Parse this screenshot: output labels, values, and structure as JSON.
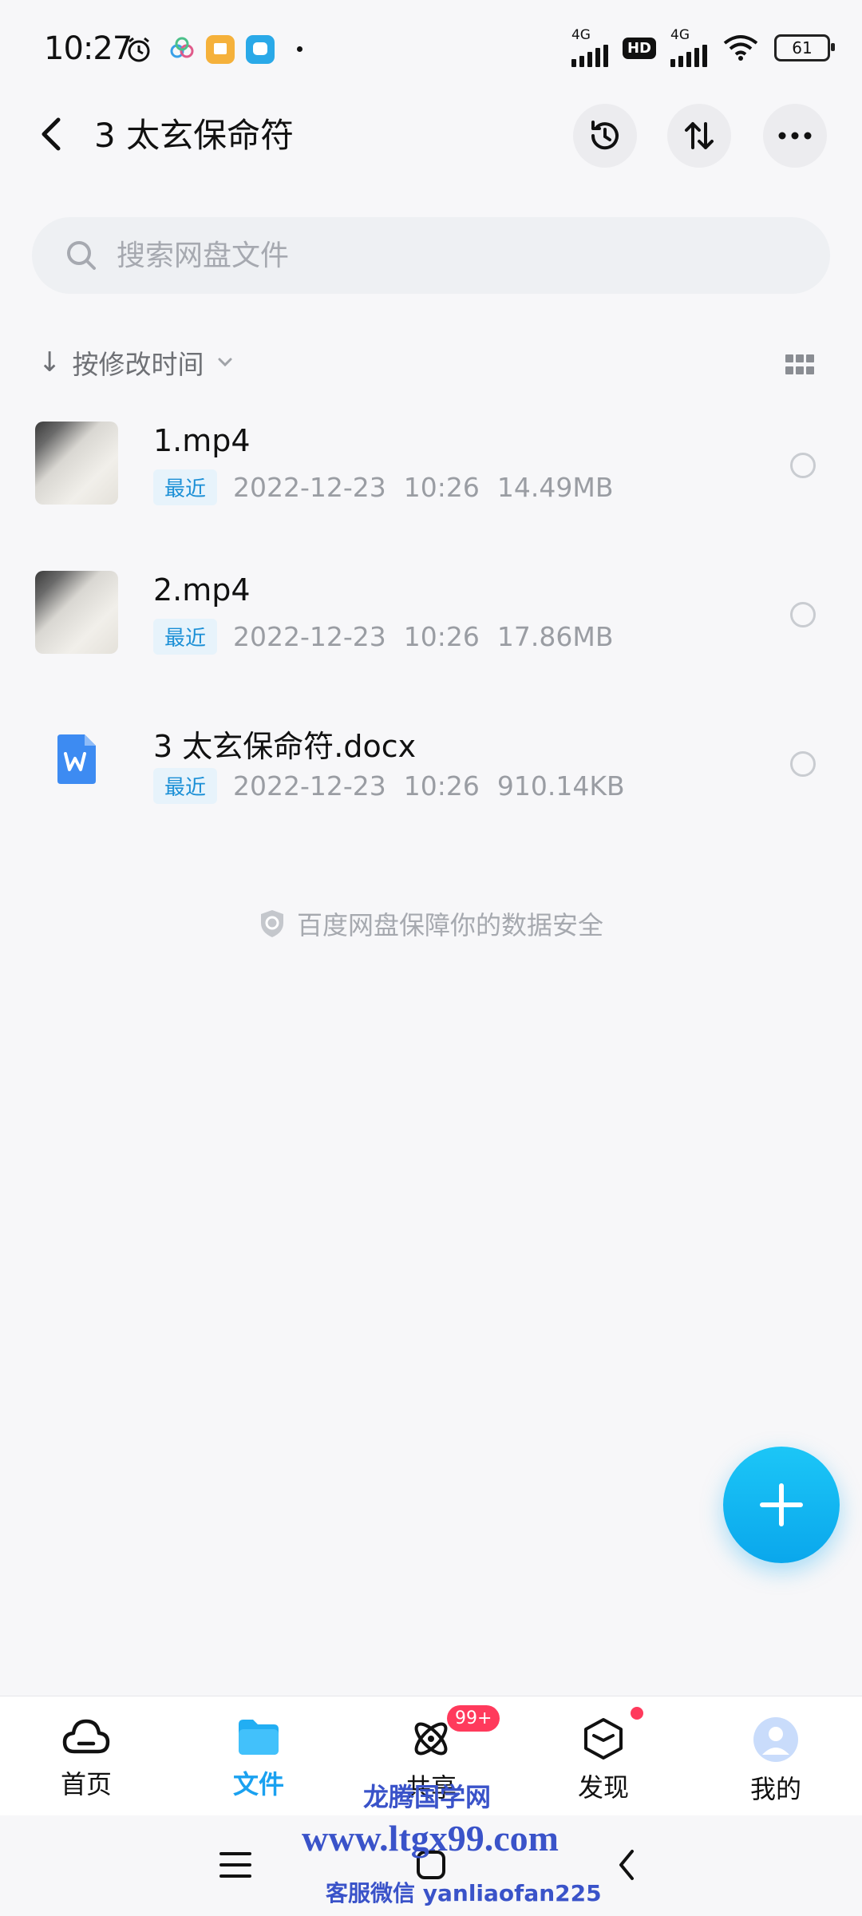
{
  "status_bar": {
    "time": "10:27",
    "network_1": "4G",
    "hd": "HD",
    "network_2": "4G",
    "battery": "61"
  },
  "header": {
    "title": "3 太玄保命符"
  },
  "search": {
    "placeholder": "搜索网盘文件"
  },
  "sort": {
    "label": "按修改时间"
  },
  "files": [
    {
      "name": "1.mp4",
      "tag": "最近",
      "date": "2022-12-23",
      "time": "10:26",
      "size": "14.49MB",
      "type": "video"
    },
    {
      "name": "2.mp4",
      "tag": "最近",
      "date": "2022-12-23",
      "time": "10:26",
      "size": "17.86MB",
      "type": "video"
    },
    {
      "name": "3 太玄保命符.docx",
      "tag": "最近",
      "date": "2022-12-23",
      "time": "10:26",
      "size": "910.14KB",
      "type": "docx"
    }
  ],
  "footer_note": "百度网盘保障你的数据安全",
  "tabs": [
    {
      "label": "首页",
      "icon": "cloud-icon"
    },
    {
      "label": "文件",
      "icon": "folder-icon"
    },
    {
      "label": "共享",
      "icon": "atom-icon",
      "badge": "99+"
    },
    {
      "label": "发现",
      "icon": "cube-icon"
    },
    {
      "label": "我的",
      "icon": "avatar-icon"
    }
  ],
  "watermark": {
    "line1": "龙腾国学网",
    "line2": "www.ltgx99.com",
    "line3": "客服微信 yanliaofan225"
  },
  "colors": {
    "accent": "#1aa1f0",
    "badge": "#ff3a5c",
    "recent_tag": "#1a8fd6",
    "watermark": "#3a53c9"
  }
}
